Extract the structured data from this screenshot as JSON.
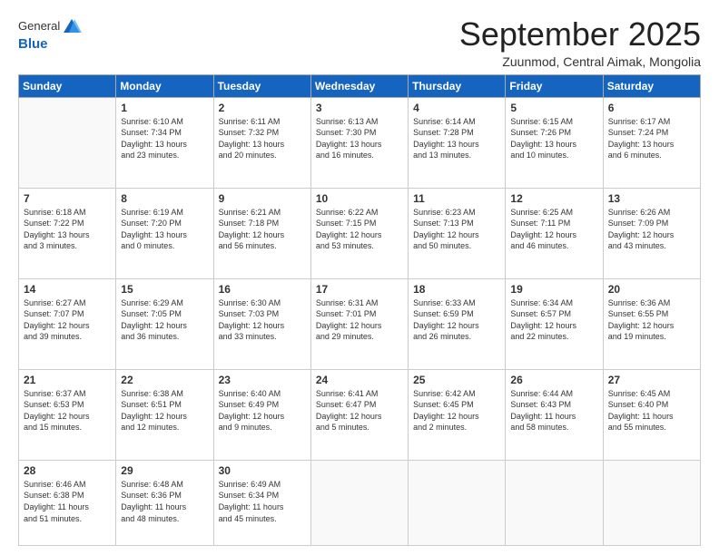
{
  "logo": {
    "general": "General",
    "blue": "Blue"
  },
  "header": {
    "month": "September 2025",
    "location": "Zuunmod, Central Aimak, Mongolia"
  },
  "weekdays": [
    "Sunday",
    "Monday",
    "Tuesday",
    "Wednesday",
    "Thursday",
    "Friday",
    "Saturday"
  ],
  "weeks": [
    [
      {
        "day": "",
        "info": ""
      },
      {
        "day": "1",
        "info": "Sunrise: 6:10 AM\nSunset: 7:34 PM\nDaylight: 13 hours\nand 23 minutes."
      },
      {
        "day": "2",
        "info": "Sunrise: 6:11 AM\nSunset: 7:32 PM\nDaylight: 13 hours\nand 20 minutes."
      },
      {
        "day": "3",
        "info": "Sunrise: 6:13 AM\nSunset: 7:30 PM\nDaylight: 13 hours\nand 16 minutes."
      },
      {
        "day": "4",
        "info": "Sunrise: 6:14 AM\nSunset: 7:28 PM\nDaylight: 13 hours\nand 13 minutes."
      },
      {
        "day": "5",
        "info": "Sunrise: 6:15 AM\nSunset: 7:26 PM\nDaylight: 13 hours\nand 10 minutes."
      },
      {
        "day": "6",
        "info": "Sunrise: 6:17 AM\nSunset: 7:24 PM\nDaylight: 13 hours\nand 6 minutes."
      }
    ],
    [
      {
        "day": "7",
        "info": "Sunrise: 6:18 AM\nSunset: 7:22 PM\nDaylight: 13 hours\nand 3 minutes."
      },
      {
        "day": "8",
        "info": "Sunrise: 6:19 AM\nSunset: 7:20 PM\nDaylight: 13 hours\nand 0 minutes."
      },
      {
        "day": "9",
        "info": "Sunrise: 6:21 AM\nSunset: 7:18 PM\nDaylight: 12 hours\nand 56 minutes."
      },
      {
        "day": "10",
        "info": "Sunrise: 6:22 AM\nSunset: 7:15 PM\nDaylight: 12 hours\nand 53 minutes."
      },
      {
        "day": "11",
        "info": "Sunrise: 6:23 AM\nSunset: 7:13 PM\nDaylight: 12 hours\nand 50 minutes."
      },
      {
        "day": "12",
        "info": "Sunrise: 6:25 AM\nSunset: 7:11 PM\nDaylight: 12 hours\nand 46 minutes."
      },
      {
        "day": "13",
        "info": "Sunrise: 6:26 AM\nSunset: 7:09 PM\nDaylight: 12 hours\nand 43 minutes."
      }
    ],
    [
      {
        "day": "14",
        "info": "Sunrise: 6:27 AM\nSunset: 7:07 PM\nDaylight: 12 hours\nand 39 minutes."
      },
      {
        "day": "15",
        "info": "Sunrise: 6:29 AM\nSunset: 7:05 PM\nDaylight: 12 hours\nand 36 minutes."
      },
      {
        "day": "16",
        "info": "Sunrise: 6:30 AM\nSunset: 7:03 PM\nDaylight: 12 hours\nand 33 minutes."
      },
      {
        "day": "17",
        "info": "Sunrise: 6:31 AM\nSunset: 7:01 PM\nDaylight: 12 hours\nand 29 minutes."
      },
      {
        "day": "18",
        "info": "Sunrise: 6:33 AM\nSunset: 6:59 PM\nDaylight: 12 hours\nand 26 minutes."
      },
      {
        "day": "19",
        "info": "Sunrise: 6:34 AM\nSunset: 6:57 PM\nDaylight: 12 hours\nand 22 minutes."
      },
      {
        "day": "20",
        "info": "Sunrise: 6:36 AM\nSunset: 6:55 PM\nDaylight: 12 hours\nand 19 minutes."
      }
    ],
    [
      {
        "day": "21",
        "info": "Sunrise: 6:37 AM\nSunset: 6:53 PM\nDaylight: 12 hours\nand 15 minutes."
      },
      {
        "day": "22",
        "info": "Sunrise: 6:38 AM\nSunset: 6:51 PM\nDaylight: 12 hours\nand 12 minutes."
      },
      {
        "day": "23",
        "info": "Sunrise: 6:40 AM\nSunset: 6:49 PM\nDaylight: 12 hours\nand 9 minutes."
      },
      {
        "day": "24",
        "info": "Sunrise: 6:41 AM\nSunset: 6:47 PM\nDaylight: 12 hours\nand 5 minutes."
      },
      {
        "day": "25",
        "info": "Sunrise: 6:42 AM\nSunset: 6:45 PM\nDaylight: 12 hours\nand 2 minutes."
      },
      {
        "day": "26",
        "info": "Sunrise: 6:44 AM\nSunset: 6:43 PM\nDaylight: 11 hours\nand 58 minutes."
      },
      {
        "day": "27",
        "info": "Sunrise: 6:45 AM\nSunset: 6:40 PM\nDaylight: 11 hours\nand 55 minutes."
      }
    ],
    [
      {
        "day": "28",
        "info": "Sunrise: 6:46 AM\nSunset: 6:38 PM\nDaylight: 11 hours\nand 51 minutes."
      },
      {
        "day": "29",
        "info": "Sunrise: 6:48 AM\nSunset: 6:36 PM\nDaylight: 11 hours\nand 48 minutes."
      },
      {
        "day": "30",
        "info": "Sunrise: 6:49 AM\nSunset: 6:34 PM\nDaylight: 11 hours\nand 45 minutes."
      },
      {
        "day": "",
        "info": ""
      },
      {
        "day": "",
        "info": ""
      },
      {
        "day": "",
        "info": ""
      },
      {
        "day": "",
        "info": ""
      }
    ]
  ]
}
